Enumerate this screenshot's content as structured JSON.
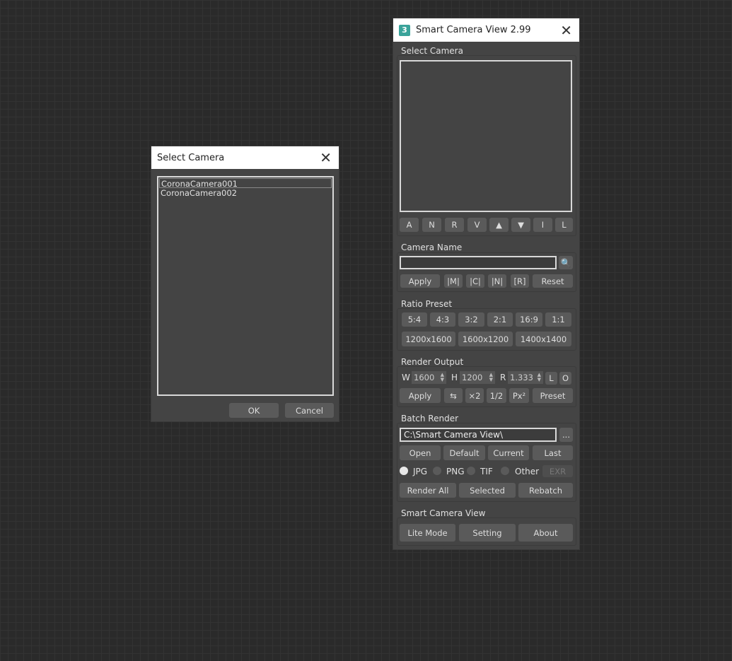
{
  "select_dialog": {
    "title": "Select Camera",
    "cameras": [
      "CoronaCamera001",
      "CoronaCamera002"
    ],
    "ok": "OK",
    "cancel": "Cancel"
  },
  "main": {
    "title": "Smart Camera View 2.99",
    "select_camera": {
      "label": "Select Camera",
      "buttons": [
        "A",
        "N",
        "R",
        "V",
        "▲",
        "▼",
        "I",
        "L"
      ]
    },
    "camera_name": {
      "label": "Camera Name",
      "value": "",
      "buttons": [
        "Apply",
        "|M|",
        "|C|",
        "|N|",
        "[R]",
        "Reset"
      ]
    },
    "ratio_preset": {
      "label": "Ratio Preset",
      "ratios": [
        "5:4",
        "4:3",
        "3:2",
        "2:1",
        "16:9",
        "1:1"
      ],
      "sizes": [
        "1200x1600",
        "1600x1200",
        "1400x1400"
      ]
    },
    "render_output": {
      "label": "Render Output",
      "w_label": "W",
      "w": "1600",
      "h_label": "H",
      "h": "1200",
      "r_label": "R",
      "r": "1.333",
      "l": "L",
      "o": "O",
      "buttons": [
        "Apply",
        "⇆",
        "×2",
        "1/2",
        "Px²",
        "Preset"
      ]
    },
    "batch_render": {
      "label": "Batch Render",
      "path": "C:\\Smart Camera View\\",
      "browse": "...",
      "buttons": [
        "Open",
        "Default",
        "Current",
        "Last"
      ],
      "formats": [
        "JPG",
        "PNG",
        "TIF",
        "Other"
      ],
      "selected_format": "JPG",
      "exr": "EXR",
      "render_buttons": [
        "Render All",
        "Selected",
        "Rebatch"
      ]
    },
    "about": {
      "label": "Smart Camera View",
      "buttons": [
        "Lite Mode",
        "Setting",
        "About"
      ]
    }
  }
}
